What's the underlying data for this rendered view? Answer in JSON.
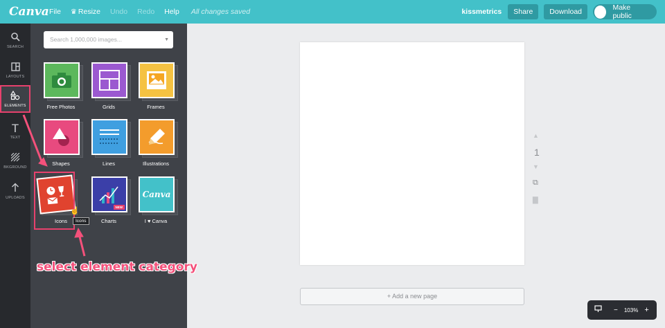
{
  "topbar": {
    "logo": "Canva",
    "menu_file": "File",
    "menu_resize": "Resize",
    "menu_undo": "Undo",
    "menu_redo": "Redo",
    "menu_help": "Help",
    "save_status": "All changes saved",
    "account_name": "kissmetrics",
    "share_label": "Share",
    "download_label": "Download",
    "make_public_label": "Make public"
  },
  "leftnav": {
    "items": [
      {
        "label": "SEARCH",
        "icon": "search-icon"
      },
      {
        "label": "LAYOUTS",
        "icon": "layouts-icon"
      },
      {
        "label": "ELEMENTS",
        "icon": "elements-icon"
      },
      {
        "label": "TEXT",
        "icon": "text-icon"
      },
      {
        "label": "BKGROUND",
        "icon": "background-icon"
      },
      {
        "label": "UPLOADS",
        "icon": "upload-icon"
      }
    ],
    "active": "ELEMENTS"
  },
  "panel": {
    "search_placeholder": "Search 1,000,000 images...",
    "tiles": [
      {
        "label": "Free Photos",
        "color": "#5cb85c",
        "icon": "camera-icon"
      },
      {
        "label": "Grids",
        "color": "#9b59d0",
        "icon": "grid-icon"
      },
      {
        "label": "Frames",
        "color": "#f5c242",
        "icon": "frame-icon"
      },
      {
        "label": "Shapes",
        "color": "#e84a7f",
        "icon": "shapes-icon"
      },
      {
        "label": "Lines",
        "color": "#3f9fe0",
        "icon": "lines-icon"
      },
      {
        "label": "Illustrations",
        "color": "#f39c2c",
        "icon": "pencil-icon"
      },
      {
        "label": "Icons",
        "color": "#e0432f",
        "icon": "icons-icon"
      },
      {
        "label": "Charts",
        "color": "#3b3fa8",
        "icon": "chart-icon"
      },
      {
        "label": "I ♥ Canva",
        "color": "#43c1c9",
        "icon": "canva-logo-icon"
      }
    ],
    "tooltip": "Icons",
    "new_badge": "NEW"
  },
  "annotation": "select element category",
  "editor": {
    "page_number": "1",
    "add_page_label": "+ Add a new page"
  },
  "zoom": {
    "value": "103%"
  }
}
